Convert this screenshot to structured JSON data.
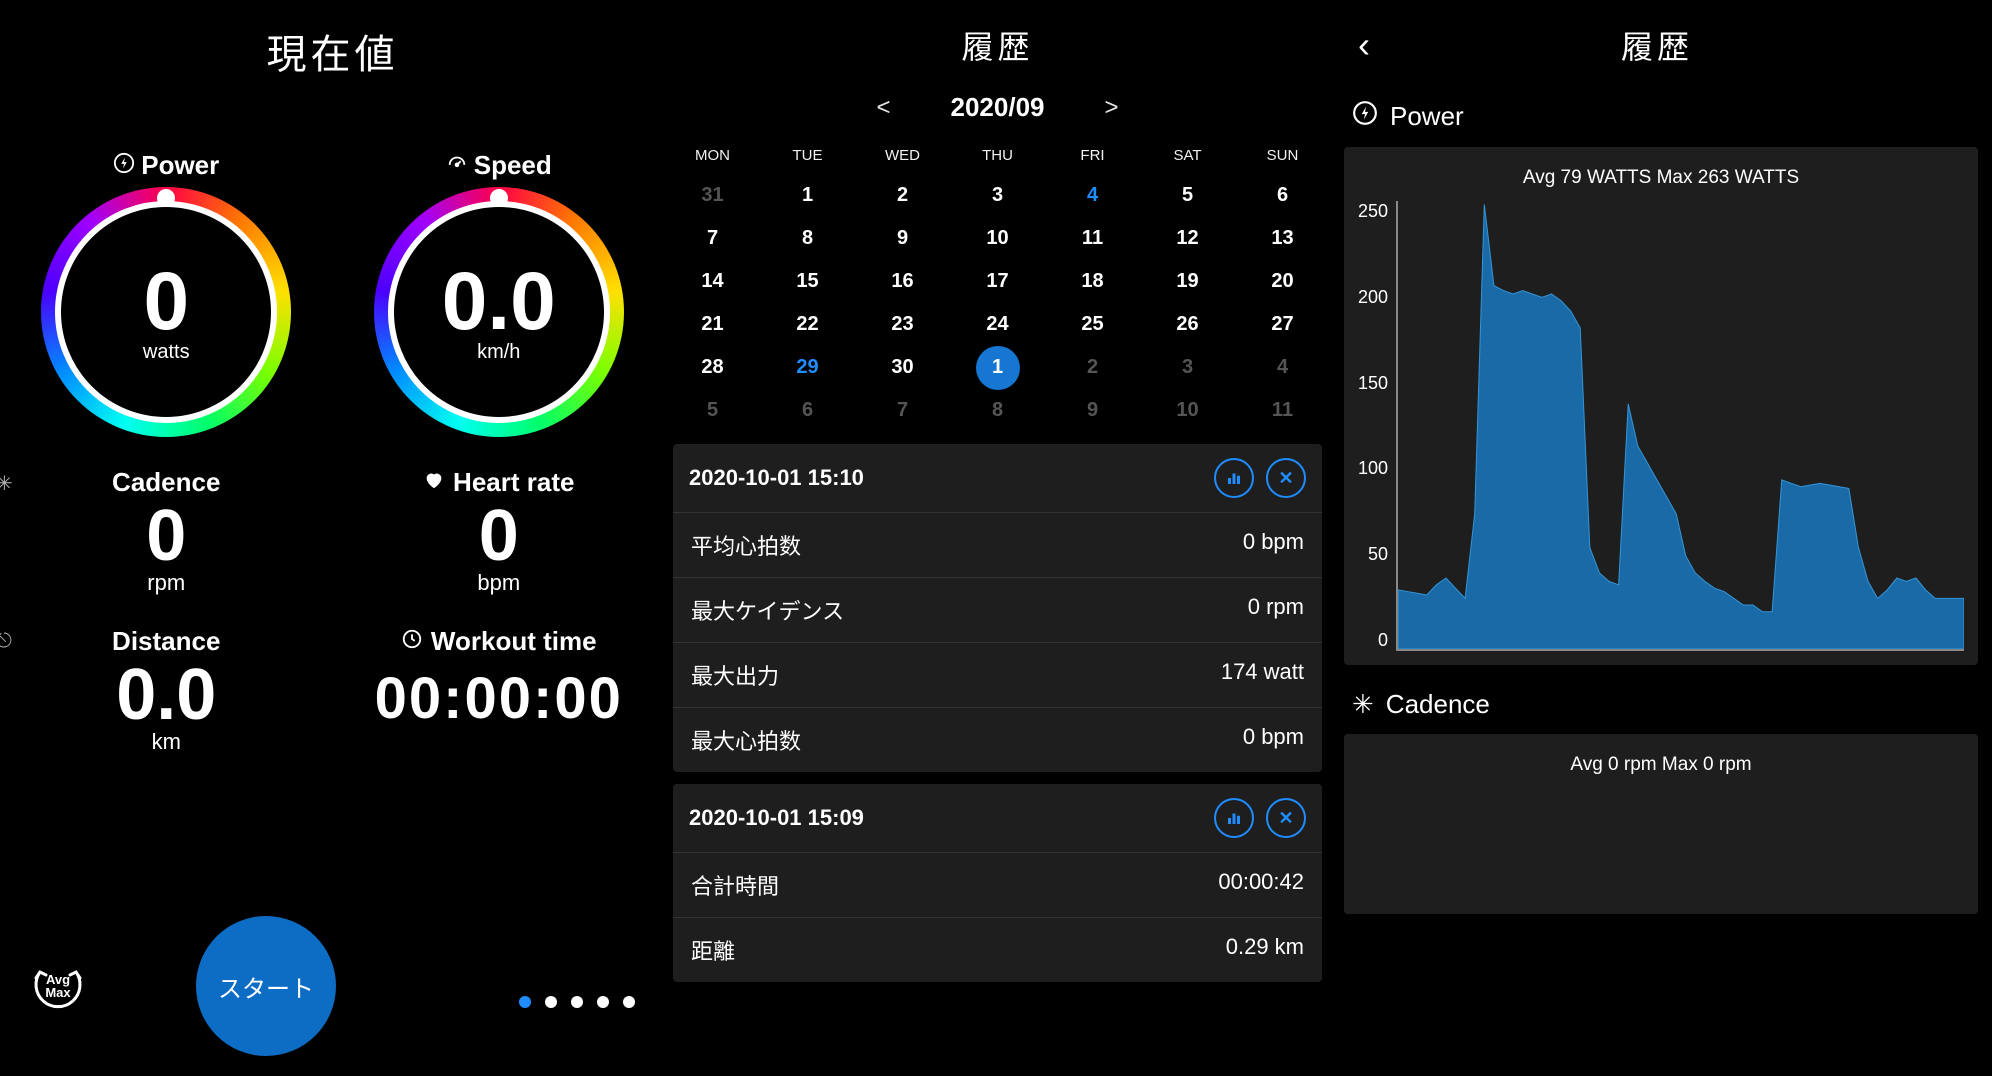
{
  "panel1": {
    "title": "現在値",
    "power": {
      "label": "Power",
      "value": "0",
      "unit": "watts"
    },
    "speed": {
      "label": "Speed",
      "value": "0.0",
      "unit": "km/h"
    },
    "cadence": {
      "label": "Cadence",
      "value": "0",
      "unit": "rpm"
    },
    "heartrate": {
      "label": "Heart rate",
      "value": "0",
      "unit": "bpm"
    },
    "distance": {
      "label": "Distance",
      "value": "0.0",
      "unit": "km"
    },
    "workout": {
      "label": "Workout time",
      "value": "00:00:00"
    },
    "avgmax": {
      "line1": "Avg",
      "line2": "Max"
    },
    "start": "スタート",
    "page_count": 5,
    "active_page": 0
  },
  "panel2": {
    "title": "履歴",
    "month": "2020/09",
    "dow": [
      "MON",
      "TUE",
      "WED",
      "THU",
      "FRI",
      "SAT",
      "SUN"
    ],
    "weeks": [
      [
        {
          "d": "31",
          "dim": true
        },
        {
          "d": "1"
        },
        {
          "d": "2"
        },
        {
          "d": "3"
        },
        {
          "d": "4",
          "blue": true
        },
        {
          "d": "5"
        },
        {
          "d": "6"
        }
      ],
      [
        {
          "d": "7"
        },
        {
          "d": "8"
        },
        {
          "d": "9"
        },
        {
          "d": "10"
        },
        {
          "d": "11"
        },
        {
          "d": "12"
        },
        {
          "d": "13"
        }
      ],
      [
        {
          "d": "14"
        },
        {
          "d": "15"
        },
        {
          "d": "16"
        },
        {
          "d": "17"
        },
        {
          "d": "18"
        },
        {
          "d": "19"
        },
        {
          "d": "20"
        }
      ],
      [
        {
          "d": "21"
        },
        {
          "d": "22"
        },
        {
          "d": "23"
        },
        {
          "d": "24"
        },
        {
          "d": "25"
        },
        {
          "d": "26"
        },
        {
          "d": "27"
        }
      ],
      [
        {
          "d": "28"
        },
        {
          "d": "29",
          "blue": true
        },
        {
          "d": "30"
        },
        {
          "d": "1",
          "sel": true
        },
        {
          "d": "2",
          "dim": true
        },
        {
          "d": "3",
          "dim": true
        },
        {
          "d": "4",
          "dim": true
        }
      ],
      [
        {
          "d": "5",
          "dim": true
        },
        {
          "d": "6",
          "dim": true
        },
        {
          "d": "7",
          "dim": true
        },
        {
          "d": "8",
          "dim": true
        },
        {
          "d": "9",
          "dim": true
        },
        {
          "d": "10",
          "dim": true
        },
        {
          "d": "11",
          "dim": true
        }
      ]
    ],
    "sessions": [
      {
        "datetime": "2020-10-01 15:10",
        "rows": [
          {
            "label": "平均心拍数",
            "value": "0 bpm"
          },
          {
            "label": "最大ケイデンス",
            "value": "0 rpm"
          },
          {
            "label": "最大出力",
            "value": "174 watt"
          },
          {
            "label": "最大心拍数",
            "value": "0 bpm"
          }
        ]
      },
      {
        "datetime": "2020-10-01 15:09",
        "rows": [
          {
            "label": "合計時間",
            "value": "00:00:42"
          },
          {
            "label": "距離",
            "value": "0.29 km"
          }
        ]
      }
    ]
  },
  "panel3": {
    "title": "履歴",
    "power": {
      "label": "Power",
      "stats": "Avg 79 WATTS   Max 263 WATTS"
    },
    "cadence": {
      "label": "Cadence",
      "stats": "Avg 0 rpm   Max 0 rpm"
    },
    "yticks": [
      "250",
      "200",
      "150",
      "100",
      "50",
      "0"
    ]
  },
  "chart_data": {
    "type": "area",
    "title": "Power",
    "ylabel": "WATTS",
    "ylim": [
      0,
      265
    ],
    "yticks": [
      0,
      50,
      100,
      150,
      200,
      250
    ],
    "stats": {
      "avg": 79,
      "max": 263
    },
    "n_points": 60,
    "values": [
      35,
      34,
      33,
      32,
      38,
      42,
      36,
      30,
      80,
      263,
      215,
      212,
      210,
      212,
      210,
      208,
      210,
      206,
      200,
      190,
      60,
      45,
      40,
      38,
      145,
      120,
      110,
      100,
      90,
      80,
      55,
      45,
      40,
      36,
      34,
      30,
      26,
      26,
      22,
      22,
      100,
      98,
      96,
      97,
      98,
      97,
      96,
      95,
      60,
      40,
      30,
      35,
      42,
      40,
      42,
      35,
      30,
      30,
      30,
      30
    ]
  }
}
